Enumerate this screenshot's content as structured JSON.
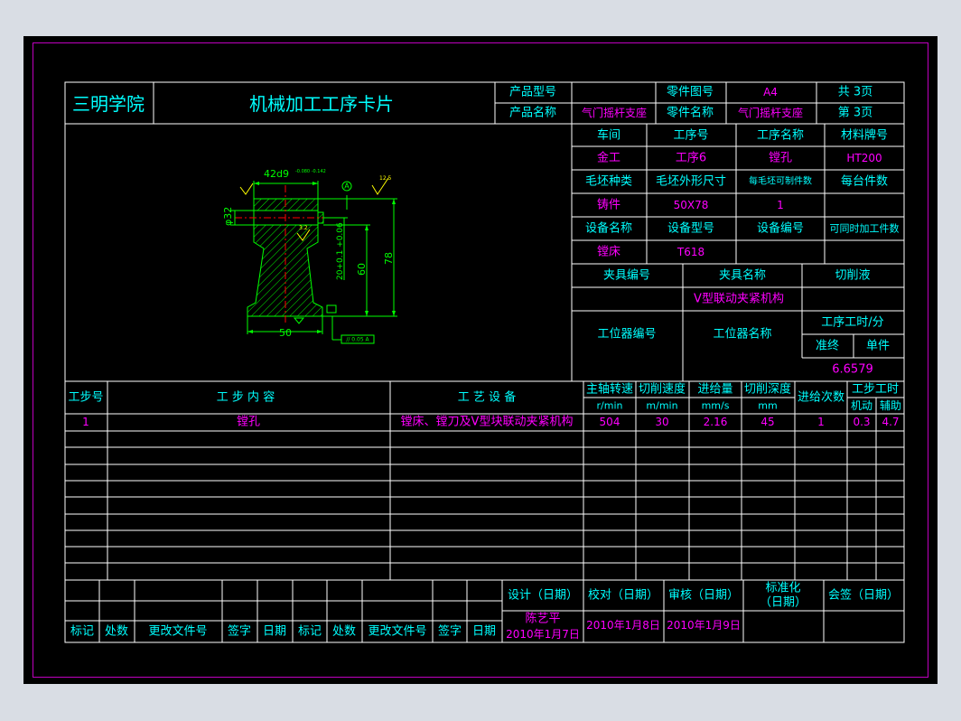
{
  "colors": {
    "line": "#ffffff",
    "cyan": "#00ffff",
    "magenta": "#ff00ff",
    "green": "#00ff00",
    "red": "#ff0000",
    "yellow": "#ffff00",
    "blue": "#5050ff",
    "frame": "#c000c0"
  },
  "header": {
    "school": "三明学院",
    "card_title": "机械加工工序卡片",
    "product_model_label": "产品型号",
    "product_model_value": "",
    "part_drawing_label": "零件图号",
    "part_drawing_value": "A4",
    "total_pages": "共 3页",
    "product_name_label": "产品名称",
    "product_name_value": "气门摇杆支座",
    "part_name_label": "零件名称",
    "part_name_value": "气门摇杆支座",
    "page_no": "第 3页"
  },
  "info": {
    "workshop_label": "车间",
    "op_no_label": "工序号",
    "op_name_label": "工序名称",
    "material_label": "材料牌号",
    "workshop": "金工",
    "op_no": "工序6",
    "op_name": "镗孔",
    "material": "HT200",
    "blank_type_label": "毛坯种类",
    "blank_size_label": "毛坯外形尺寸",
    "pieces_per_blank_label": "每毛坯可制件数",
    "pieces_per_machine_label": "每台件数",
    "blank_type": "铸件",
    "blank_size": "50X78",
    "pieces_per_blank": "1",
    "pieces_per_machine": "",
    "equip_name_label": "设备名称",
    "equip_model_label": "设备型号",
    "equip_no_label": "设备编号",
    "simultaneous_label": "可同时加工件数",
    "equip_name": "镗床",
    "equip_model": "T618",
    "fixture_no_label": "夹具编号",
    "fixture_name_label": "夹具名称",
    "coolant_label": "切削液",
    "fixture_name": "V型联动夹紧机构",
    "station_no_label": "工位器编号",
    "station_name_label": "工位器名称",
    "op_hours_label": "工序工时/分",
    "prep_label": "准终",
    "unit_label": "单件",
    "unit_time": "6.6579"
  },
  "steps": {
    "headers": {
      "step_no": "工步号",
      "content": "工  步  内  容",
      "equipment": "工 艺 设 备",
      "spindle": "主轴转速",
      "cut_speed": "切削速度",
      "feed": "进给量",
      "depth": "切削深度",
      "passes": "进给次数",
      "step_time": "工步工时",
      "machine": "机动",
      "aux": "辅助"
    },
    "units": {
      "spindle": "r/min",
      "cut_speed": "m/min",
      "feed": "mm/s",
      "depth": "mm"
    },
    "rows": [
      {
        "no": "1",
        "content": "镗孔",
        "equipment": "镗床、镗刀及V型块联动夹紧机构",
        "spindle": "504",
        "cut_speed": "30",
        "feed": "2.16",
        "depth": "45",
        "passes": "1",
        "machine": "0.3",
        "aux": "4.7"
      }
    ]
  },
  "footer": {
    "design_label": "设计（日期）",
    "check_label": "校对（日期）",
    "review_label": "审核（日期）",
    "std_label1": "标准化",
    "std_label2": "（日期）",
    "sign_label": "会签（日期）",
    "designer": "陈艺平",
    "design_date": "2010年1月7日",
    "check_date": "2010年1月8日",
    "review_date": "2010年1月9日",
    "rev_labels": [
      "标记",
      "处数",
      "更改文件号",
      "签字",
      "日期",
      "标记",
      "处数",
      "更改文件号",
      "签字",
      "日期"
    ]
  },
  "drawing": {
    "dim_width": "42d9",
    "dim_tol": "-0.080 -0.142",
    "dim_bore": "φ32",
    "dim_height": "78",
    "dim_60": "60",
    "dim_20": "20+0.1 +0.06",
    "dim_base": "50",
    "datum": "A",
    "roughness1": "12.5",
    "roughness2": "3.2",
    "geo_tol": "// 0.05 A"
  }
}
